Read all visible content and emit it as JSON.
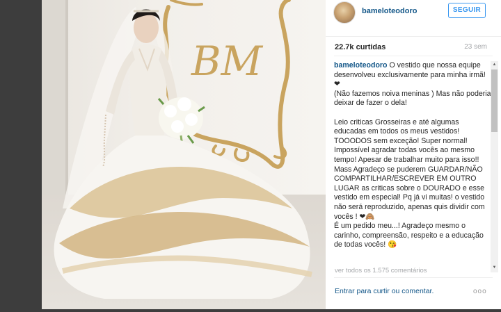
{
  "post": {
    "username": "bameloteodoro",
    "follow_label": "SEGUIR",
    "likes": "22.7k curtidas",
    "time_ago": "23 sem",
    "caption_user": "bameloteodoro",
    "caption_text": " O vestido que nossa equipe desenvolveu exclusivamente para minha irmã! ❤\n(Não fazemos noiva meninas ) Mas não poderia deixar de fazer o dela!\n\nLeio criticas Grosseiras e até algumas educadas em todos os meus vestidos! TOOODOS sem exceção! Super normal! Impossível agradar todas vocês ao mesmo tempo! Apesar de trabalhar muito para isso!! Mass Agradeço se puderem GUARDAR/NÃO COMPARTILHAR/ESCREVER EM OUTRO LUGAR as criticas sobre o DOURADO e esse vestido em especial! Pq já vi muitas! o vestido não será reproduzido, apenas quis dividir com vocês ! ❤🙈\nÉ um pedido meu...! Agradeço mesmo o carinho, compreensão, respeito e a educação de todas vocês! 😘",
    "view_all_comments": "ver todos os 1.575 comentários",
    "login_prompt": "Entrar para curtir ou comentar.",
    "more_icon_glyph": "ooo"
  },
  "photo": {
    "monogram": "BM",
    "icon": "wedding-dress-photo"
  },
  "colors": {
    "link_blue": "#125688",
    "follow_blue": "#3897f0",
    "gold": "#c9a45f",
    "muted": "#a5a7aa"
  }
}
